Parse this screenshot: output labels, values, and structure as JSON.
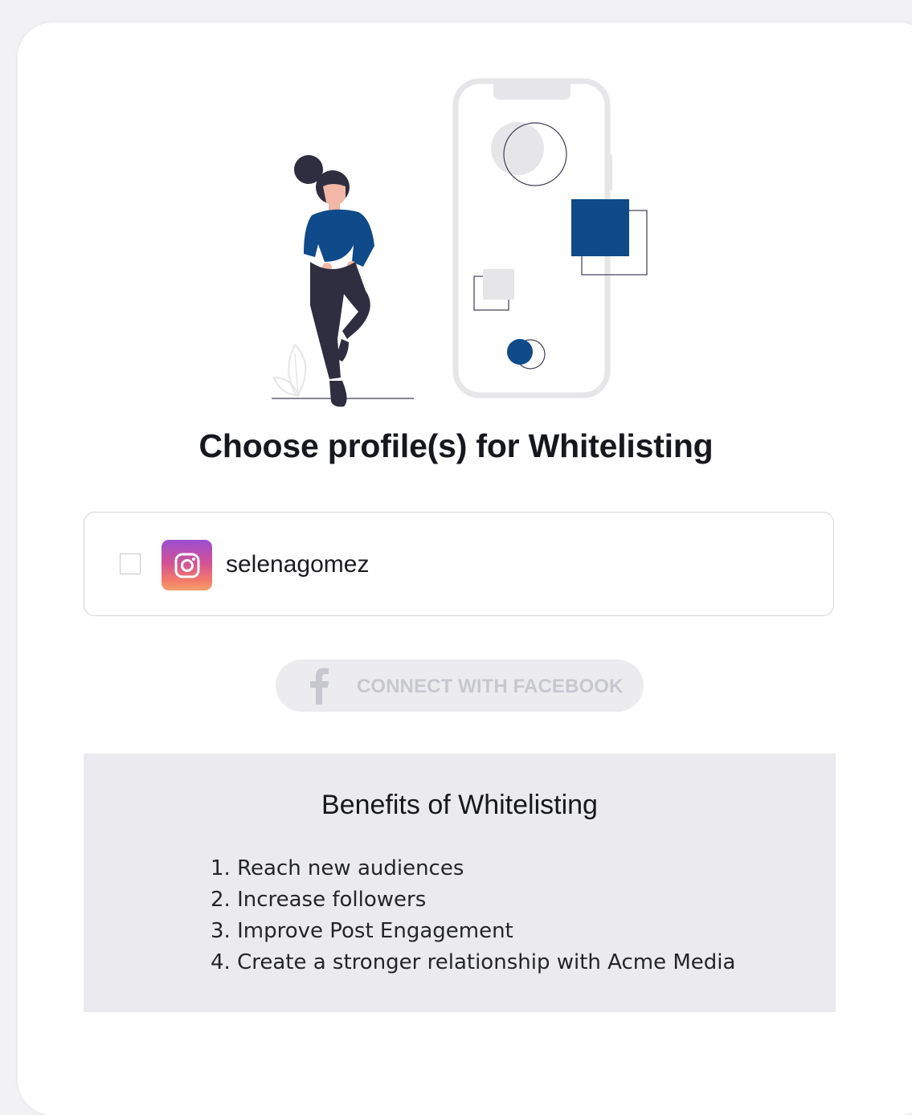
{
  "heading": "Choose profile(s) for Whitelisting",
  "profiles": [
    {
      "platform": "instagram",
      "icon": "instagram-icon",
      "username": "selenagomez",
      "checked": false
    }
  ],
  "connect_button": {
    "label": "CONNECT WITH FACEBOOK",
    "icon": "facebook-icon",
    "disabled": true
  },
  "benefits": {
    "title": "Benefits of Whitelisting",
    "items": [
      "1. Reach new audiences",
      "2. Increase followers",
      "3. Improve Post Engagement",
      "4. Create a stronger relationship with Acme Media"
    ]
  },
  "colors": {
    "accent": "#0f4a8a",
    "button_bg": "#ececef",
    "button_text": "#c7c7cf",
    "benefits_bg": "#ebebef"
  }
}
